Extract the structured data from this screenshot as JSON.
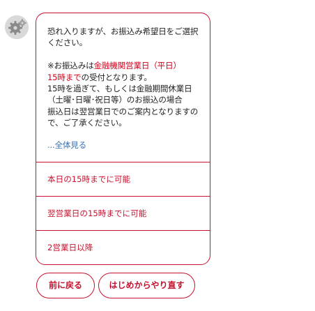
{
  "message": {
    "line1": "恐れ入りますが、お振込み希望日をご選択",
    "line2": "ください。",
    "notice_a": "※お振込みは",
    "notice_red1": "金融機関営業日（平日）",
    "notice_red2": "15時まで",
    "notice_b": "の受付となります。",
    "body1": "15時を過ぎて、もしくは金融期間休業日",
    "body2": "（土曜･日曜･祝日等）のお振込の場合",
    "body3": "振込日は翌営業日でのご案内となりますの",
    "body4": "で、ご了承ください。",
    "see_all": "...全体見る"
  },
  "options": [
    {
      "label": "本日の15時までに可能"
    },
    {
      "label": "翌営業日の15時までに可能"
    },
    {
      "label": "2営業日以降"
    }
  ],
  "buttons": {
    "back": "前に戻る",
    "restart": "はじめからやり直す"
  },
  "colors": {
    "accent": "#c8102e",
    "link": "#3a6fb0",
    "text": "#222222"
  },
  "icons": {
    "avatar": "gear-avatar-icon"
  }
}
